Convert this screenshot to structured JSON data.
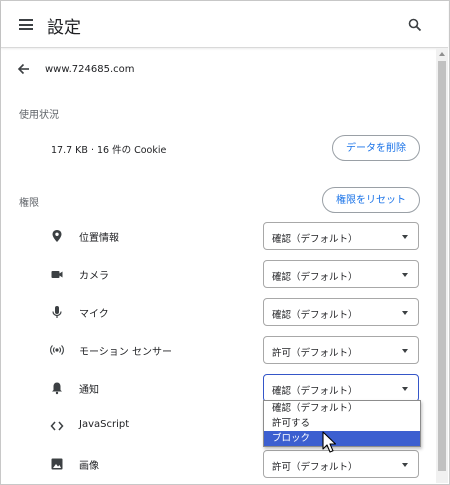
{
  "header": {
    "title": "設定",
    "menu_icon": "hamburger-menu-icon",
    "search_icon": "search-icon"
  },
  "site": {
    "url": "www.724685.com",
    "back_icon": "arrow-back-icon"
  },
  "usage": {
    "section_label": "使用状況",
    "summary": "17.7 KB · 16 件の Cookie",
    "clear_button": "データを削除"
  },
  "permissions": {
    "section_label": "権限",
    "reset_button": "権限をリセット",
    "items": [
      {
        "label": "位置情報",
        "icon": "location-pin-icon",
        "value": "確認（デフォルト）"
      },
      {
        "label": "カメラ",
        "icon": "camera-icon",
        "value": "確認（デフォルト）"
      },
      {
        "label": "マイク",
        "icon": "microphone-icon",
        "value": "確認（デフォルト）"
      },
      {
        "label": "モーション センサー",
        "icon": "motion-sensor-icon",
        "value": "許可（デフォルト）"
      },
      {
        "label": "通知",
        "icon": "bell-icon",
        "value": "確認（デフォルト）"
      },
      {
        "label": "JavaScript",
        "icon": "code-icon",
        "value": ""
      },
      {
        "label": "画像",
        "icon": "image-icon",
        "value": "許可（デフォルト）"
      }
    ]
  },
  "notification_dropdown": {
    "options": [
      "確認（デフォルト）",
      "許可する",
      "ブロック"
    ],
    "highlighted": "ブロック"
  },
  "colors": {
    "accent": "#1a73e8",
    "dropdown_highlight": "#3c5fd0",
    "focus_border": "#3556c8"
  }
}
